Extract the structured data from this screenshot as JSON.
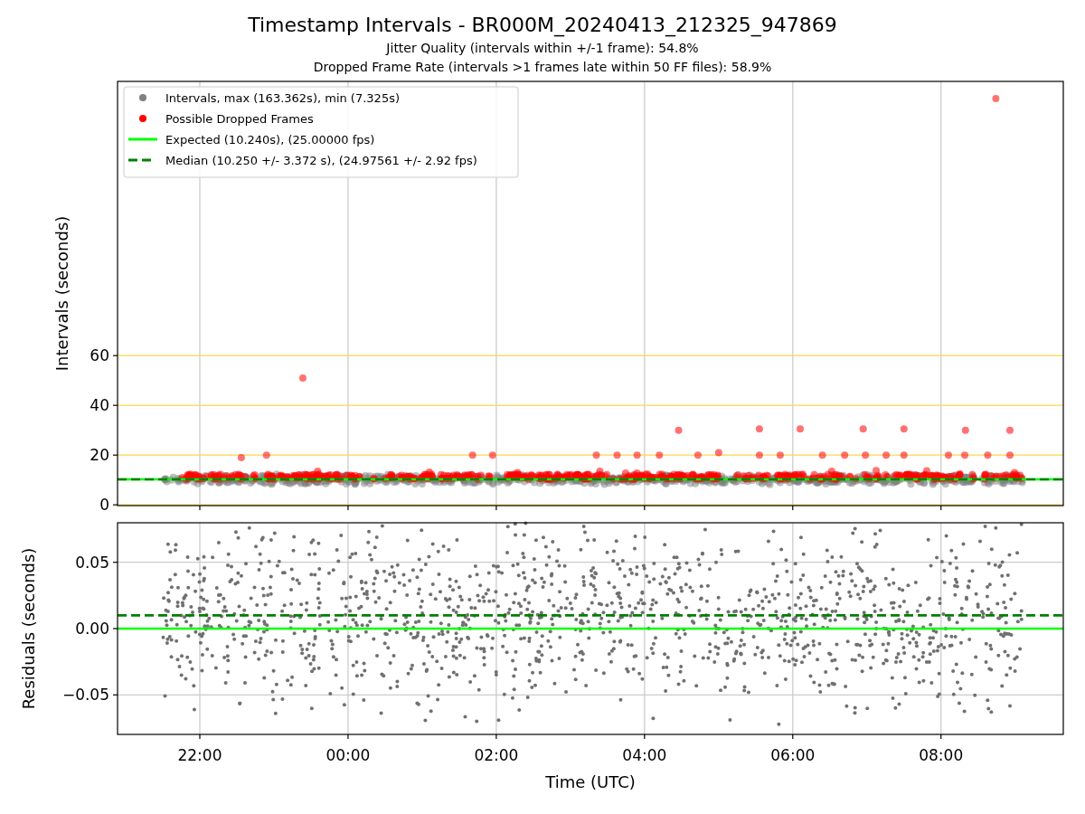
{
  "figure": {
    "title": "Timestamp Intervals - BR000M_20240413_212325_947869",
    "subtitles": [
      "Jitter Quality (intervals within +/-1 frame): 54.8%",
      "Dropped Frame Rate (intervals >1 frames late within 50 FF files): 58.9%"
    ],
    "intervals_panel": {
      "ylabel": "Intervals (seconds)",
      "y_tick_labels": [
        "60",
        "40",
        "20",
        "0"
      ],
      "legend": [
        {
          "label": "Intervals, max (163.362s), min (7.325s)",
          "color": "#808080",
          "kind": "points"
        },
        {
          "label": "Possible Dropped Frames",
          "color": "#ff0000",
          "kind": "points"
        },
        {
          "label": "Expected (10.240s), (25.00000 fps)",
          "color": "#00ff00",
          "kind": "line"
        },
        {
          "label": "Median (10.250 +/- 3.372 s), (24.97561 +/- 2.92 fps)",
          "color": "#008000",
          "kind": "dashed"
        }
      ]
    },
    "residuals_panel": {
      "ylabel": "Residuals (seconds)",
      "y_tick_labels": [
        "0.05",
        "0.00",
        "−0.05"
      ],
      "x_tick_labels": [
        "22:00",
        "00:00",
        "02:00",
        "04:00",
        "06:00",
        "08:00"
      ],
      "xlabel": "Time (UTC)"
    }
  }
}
